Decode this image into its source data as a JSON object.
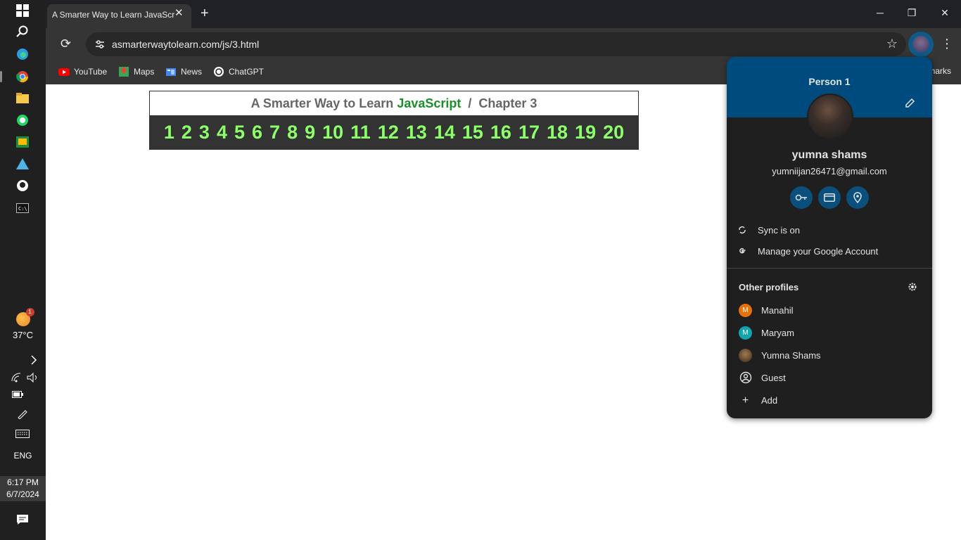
{
  "taskbar": {
    "weather_temp": "37°C",
    "weather_badge": "1",
    "language": "ENG",
    "time": "6:17 PM",
    "date": "6/7/2024"
  },
  "browser": {
    "tab_title": "A Smarter Way to Learn JavaScr",
    "url": "asmarterwaytolearn.com/js/3.html",
    "bookmarks": [
      "YouTube",
      "Maps",
      "News",
      "ChatGPT"
    ],
    "bookmarks_overflow": "marks"
  },
  "page": {
    "title_prefix": "A Smarter Way to Learn ",
    "title_js": "JavaScript",
    "title_suffix": "  /  Chapter 3",
    "chapters": [
      "1",
      "2",
      "3",
      "4",
      "5",
      "6",
      "7",
      "8",
      "9",
      "10",
      "11",
      "12",
      "13",
      "14",
      "15",
      "16",
      "17",
      "18",
      "19",
      "20"
    ]
  },
  "profile_popup": {
    "person_label": "Person 1",
    "name": "yumna shams",
    "email": "yumniijan26471@gmail.com",
    "sync_label": "Sync is on",
    "manage_label": "Manage your Google Account",
    "other_profiles_title": "Other profiles",
    "profiles": [
      {
        "name": "Manahil",
        "initial": "M",
        "color": "#e8710a"
      },
      {
        "name": "Maryam",
        "initial": "M",
        "color": "#12a4af"
      },
      {
        "name": "Yumna Shams",
        "initial": "",
        "color": "#6b4a2a"
      }
    ],
    "guest_label": "Guest",
    "add_label": "Add"
  },
  "colors": {
    "popup_header": "#004b7e",
    "chapter_green": "#8cff6a",
    "js_green": "#1a8f2a"
  }
}
